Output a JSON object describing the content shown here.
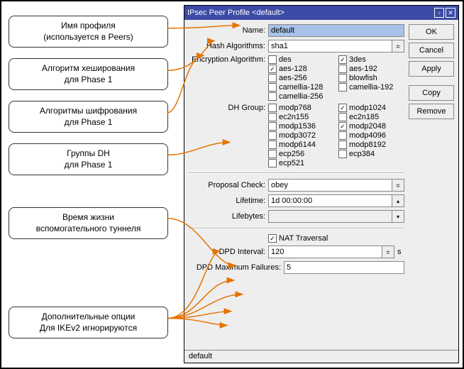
{
  "window": {
    "title": "IPsec Peer Profile <default>"
  },
  "buttons": {
    "ok": "OK",
    "cancel": "Cancel",
    "apply": "Apply",
    "copy": "Copy",
    "remove": "Remove"
  },
  "labels": {
    "name": "Name:",
    "hash": "Hash Algorithms:",
    "enc": "Encryption Algorithm:",
    "dh": "DH Group:",
    "proposal": "Proposal Check:",
    "lifetime": "Lifetime:",
    "lifebytes": "Lifebytes:",
    "nat": "NAT Traversal",
    "dpd_int": "DPD Interval:",
    "dpd_max": "DPD Maximum Failures:",
    "unit_s": "s"
  },
  "values": {
    "name": "default",
    "hash": "sha1",
    "proposal": "obey",
    "lifetime": "1d 00:00:00",
    "lifebytes": "",
    "dpd_interval": "120",
    "dpd_max": "5",
    "nat_checked": true
  },
  "enc_opts": [
    {
      "label": "des",
      "checked": false
    },
    {
      "label": "3des",
      "checked": true
    },
    {
      "label": "aes-128",
      "checked": true
    },
    {
      "label": "aes-192",
      "checked": false
    },
    {
      "label": "aes-256",
      "checked": false
    },
    {
      "label": "blowfish",
      "checked": false
    },
    {
      "label": "camellia-128",
      "checked": false
    },
    {
      "label": "camellia-192",
      "checked": false
    },
    {
      "label": "camellia-256",
      "checked": false
    }
  ],
  "dh_opts": [
    {
      "label": "modp768",
      "checked": false
    },
    {
      "label": "modp1024",
      "checked": true
    },
    {
      "label": "ec2n155",
      "checked": false
    },
    {
      "label": "ec2n185",
      "checked": false
    },
    {
      "label": "modp1536",
      "checked": false
    },
    {
      "label": "modp2048",
      "checked": true
    },
    {
      "label": "modp3072",
      "checked": false
    },
    {
      "label": "modp4096",
      "checked": false
    },
    {
      "label": "modp6144",
      "checked": false
    },
    {
      "label": "modp8192",
      "checked": false
    },
    {
      "label": "ecp256",
      "checked": false
    },
    {
      "label": "ecp384",
      "checked": false
    },
    {
      "label": "ecp521",
      "checked": false
    }
  ],
  "status": "default",
  "callouts": [
    "Имя профиля\n(используется в Peers)",
    "Алгоритм хеширования\nдля Phase 1",
    "Алгоритмы шифрования\nдля Phase 1",
    "Группы DH\nдля Phase 1",
    "Время жизни\nвспомогательного туннеля",
    "Дополнительные опции\nДля IKEv2 игнорируются"
  ]
}
